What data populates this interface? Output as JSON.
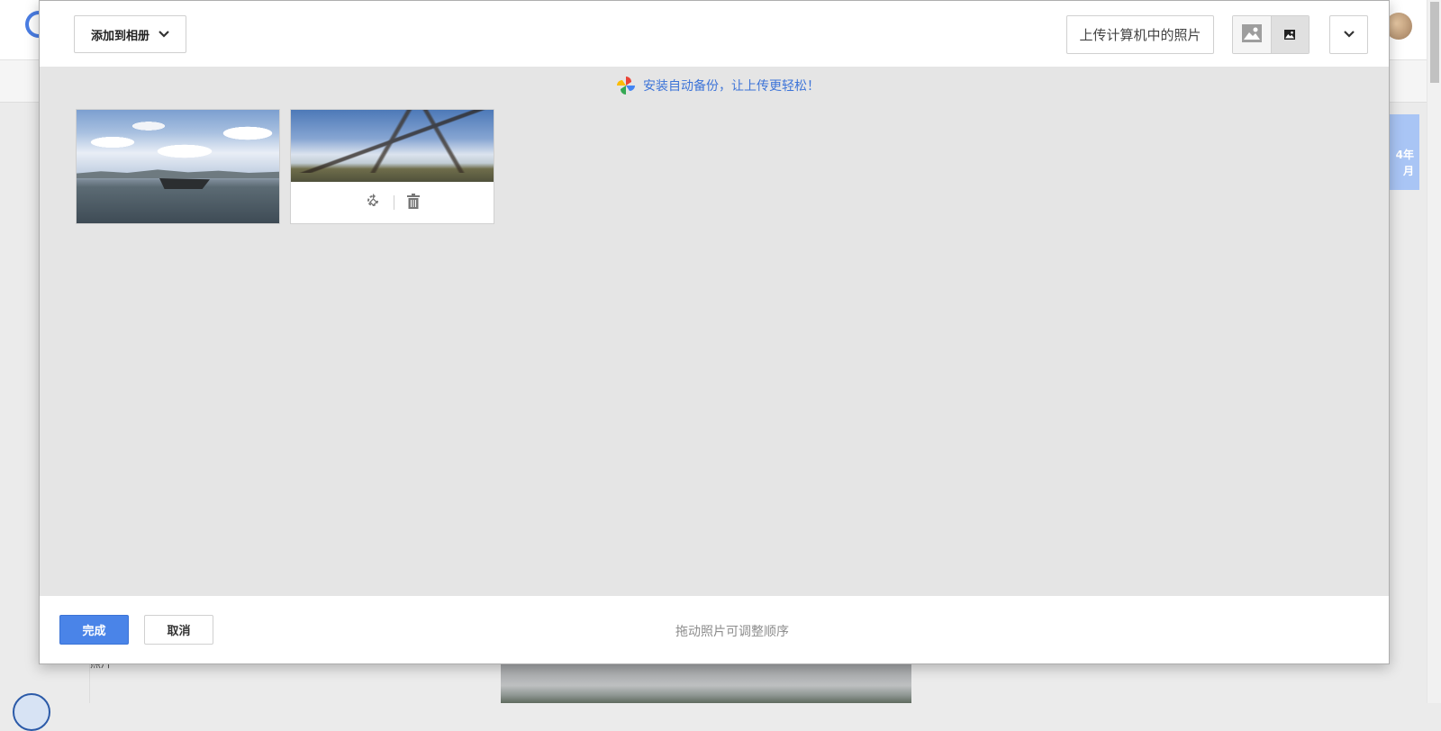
{
  "background": {
    "date_tile_line1": "4年",
    "date_tile_line2": "月",
    "left_text": "照片"
  },
  "dialog": {
    "header": {
      "add_to_album_label": "添加到相册",
      "upload_label": "上传计算机中的照片",
      "view_options": [
        "large-thumbnails-icon",
        "small-thumbnails-icon"
      ],
      "active_view": "small-thumbnails-icon"
    },
    "promo": {
      "text": "安装自动备份，让上传更轻松！",
      "icon": "photos-pinwheel-icon"
    },
    "photos": [
      {
        "name": "lake-boat-photo",
        "selected": false
      },
      {
        "name": "tree-sky-photo",
        "selected": true,
        "actions": [
          "rotate-icon",
          "trash-icon"
        ]
      }
    ],
    "footer": {
      "done_label": "完成",
      "cancel_label": "取消",
      "hint_text": "拖动照片可调整顺序"
    }
  },
  "colors": {
    "primary_button": "#4a84e8",
    "link": "#3d74d8",
    "dialog_body": "#e5e5e5"
  }
}
